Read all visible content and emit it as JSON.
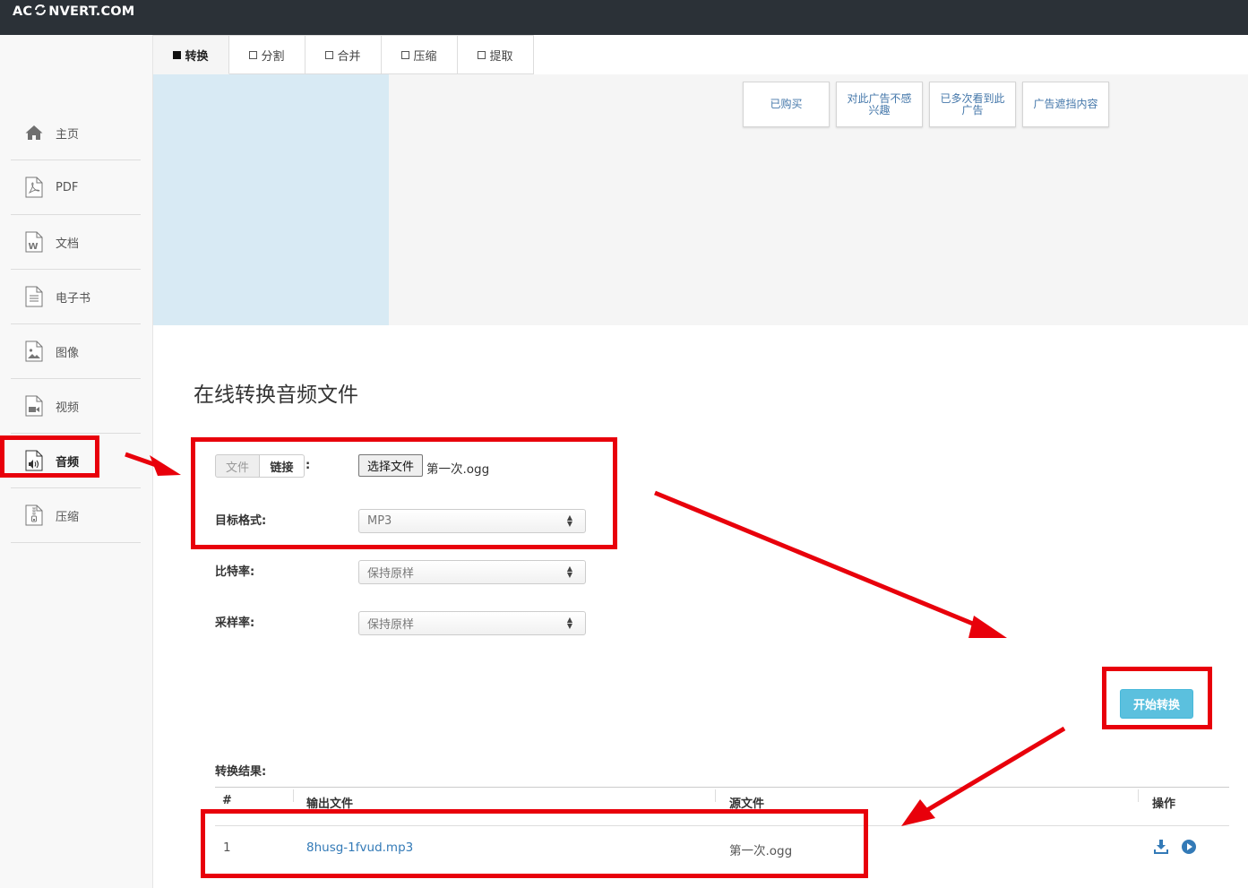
{
  "header": {
    "logo_left": "AC",
    "logo_right": "NVERT.COM"
  },
  "sidebar": {
    "items": [
      {
        "label": "主页",
        "icon": "home-icon"
      },
      {
        "label": "PDF",
        "icon": "pdf-file-icon"
      },
      {
        "label": "文档",
        "icon": "word-file-icon"
      },
      {
        "label": "电子书",
        "icon": "ebook-file-icon"
      },
      {
        "label": "图像",
        "icon": "image-file-icon"
      },
      {
        "label": "视频",
        "icon": "video-file-icon"
      },
      {
        "label": "音频",
        "icon": "audio-file-icon",
        "active": true
      },
      {
        "label": "压缩",
        "icon": "archive-file-icon"
      }
    ]
  },
  "tabs": [
    {
      "label": "转换",
      "active": true
    },
    {
      "label": "分割"
    },
    {
      "label": "合并"
    },
    {
      "label": "压缩"
    },
    {
      "label": "提取"
    }
  ],
  "ad": {
    "buttons": [
      "已购买",
      "对此广告不感兴趣",
      "已多次看到此广告",
      "广告遮挡内容"
    ]
  },
  "main": {
    "title": "在线转换音频文件",
    "input_toggle": {
      "file": "文件",
      "link": "链接",
      "colon": ":"
    },
    "file_input": {
      "button": "选择文件",
      "filename": "第一次.ogg"
    },
    "fields": [
      {
        "label": "目标格式:",
        "value": "MP3"
      },
      {
        "label": "比特率:",
        "value": "保持原样"
      },
      {
        "label": "采样率:",
        "value": "保持原样"
      }
    ],
    "convert_button": "开始转换"
  },
  "results": {
    "label": "转换结果:",
    "columns": [
      "#",
      "输出文件",
      "源文件",
      "操作"
    ],
    "rows": [
      {
        "index": "1",
        "output": "8husg-1fvud.mp3",
        "source": "第一次.ogg"
      }
    ]
  },
  "colors": {
    "navbar": "#2b3137",
    "primary_button": "#5bc0de",
    "link": "#337ab7",
    "annotation": "#e8000b"
  }
}
